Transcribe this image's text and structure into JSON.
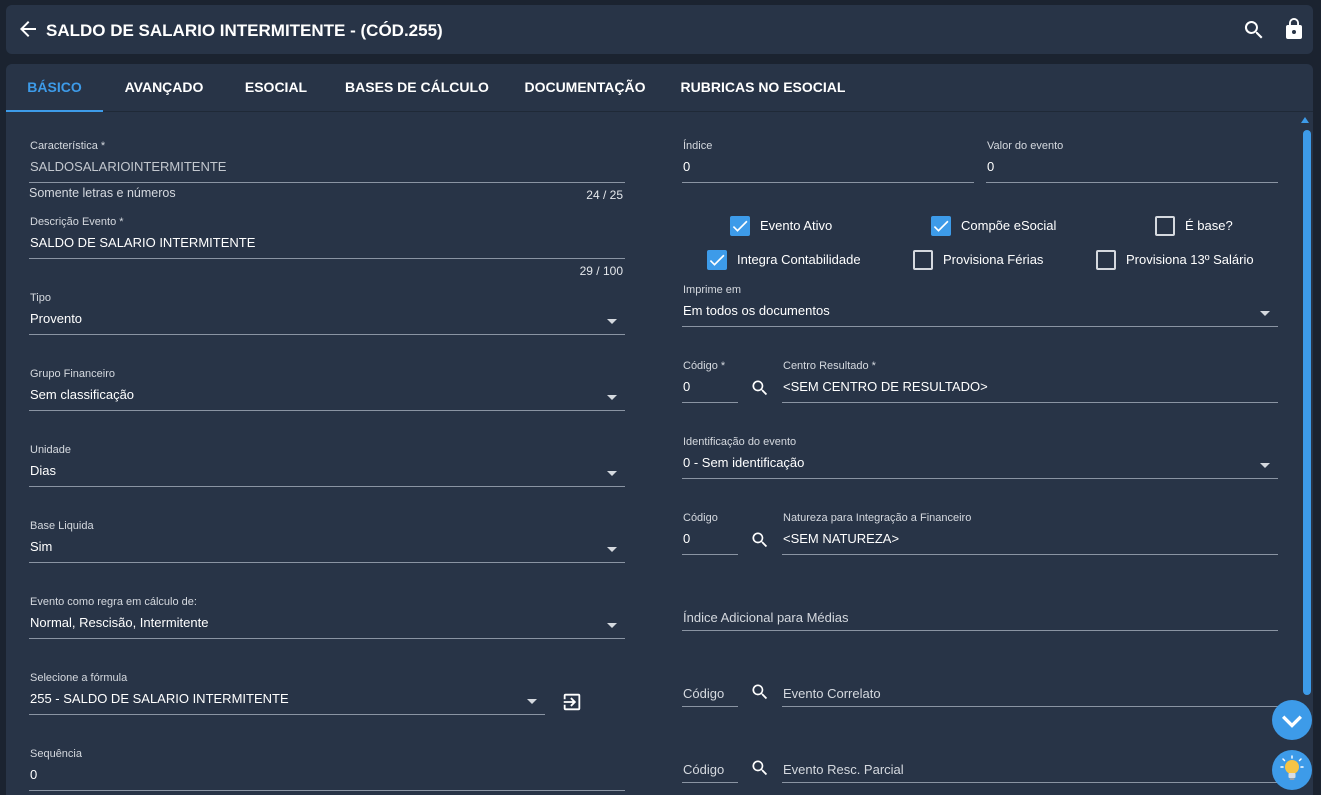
{
  "header": {
    "title": "SALDO DE SALARIO INTERMITENTE - (CÓD.255)",
    "icons": [
      "arrow-left-icon",
      "search-icon",
      "lock-icon"
    ]
  },
  "tabs": [
    {
      "label": "BÁSICO",
      "active": true
    },
    {
      "label": "AVANÇADO",
      "active": false
    },
    {
      "label": "ESOCIAL",
      "active": false
    },
    {
      "label": "BASES DE CÁLCULO",
      "active": false
    },
    {
      "label": "DOCUMENTAÇÃO",
      "active": false
    },
    {
      "label": "RUBRICAS NO ESOCIAL",
      "active": false
    }
  ],
  "left": {
    "caracteristica": {
      "label": "Característica *",
      "value": "SALDOSALARIOINTERMITENTE",
      "hint": "Somente letras e números",
      "counter": "24 / 25"
    },
    "descricao": {
      "label": "Descrição Evento *",
      "value": "SALDO DE SALARIO INTERMITENTE",
      "counter": "29 / 100"
    },
    "tipo": {
      "label": "Tipo",
      "value": "Provento"
    },
    "grupo": {
      "label": "Grupo Financeiro",
      "value": "Sem classificação"
    },
    "unidade": {
      "label": "Unidade",
      "value": "Dias"
    },
    "base_liquida": {
      "label": "Base Liquida",
      "value": "Sim"
    },
    "evento_regra": {
      "label": "Evento como regra em cálculo de:",
      "value": "Normal, Rescisão, Intermitente"
    },
    "formula": {
      "label": "Selecione a fórmula",
      "value": "255 - SALDO DE SALARIO INTERMITENTE"
    },
    "sequencia": {
      "label": "Sequência",
      "value": "0"
    }
  },
  "right": {
    "indice": {
      "label": "Índice",
      "value": "0"
    },
    "valor_evento": {
      "label": "Valor do evento",
      "value": "0"
    },
    "checkboxes": [
      {
        "label": "Evento Ativo",
        "checked": true
      },
      {
        "label": "Compõe eSocial",
        "checked": true
      },
      {
        "label": "É base?",
        "checked": false
      },
      {
        "label": "Integra Contabilidade",
        "checked": true
      },
      {
        "label": "Provisiona Férias",
        "checked": false
      },
      {
        "label": "Provisiona 13º Salário",
        "checked": false
      }
    ],
    "imprime": {
      "label": "Imprime em",
      "value": "Em todos os documentos"
    },
    "codigo1": {
      "label": "Código *",
      "value": "0"
    },
    "centro": {
      "label": "Centro Resultado *",
      "value": "<SEM CENTRO DE RESULTADO>"
    },
    "identificacao": {
      "label": "Identificação do evento",
      "value": "0 - Sem identificação"
    },
    "codigo2": {
      "label": "Código",
      "value": "0"
    },
    "natureza": {
      "label": "Natureza para Integração a Financeiro",
      "value": "<SEM NATUREZA>"
    },
    "indice_adicional": {
      "placeholder": "Índice Adicional para Médias"
    },
    "codigo3": {
      "placeholder": "Código"
    },
    "evento_correlato": {
      "placeholder": "Evento Correlato"
    },
    "codigo4": {
      "placeholder": "Código"
    },
    "evento_resc": {
      "placeholder": "Evento Resc. Parcial"
    }
  },
  "colors": {
    "accent": "#3d9be9",
    "background": "#1b2330",
    "panel": "#283447"
  }
}
